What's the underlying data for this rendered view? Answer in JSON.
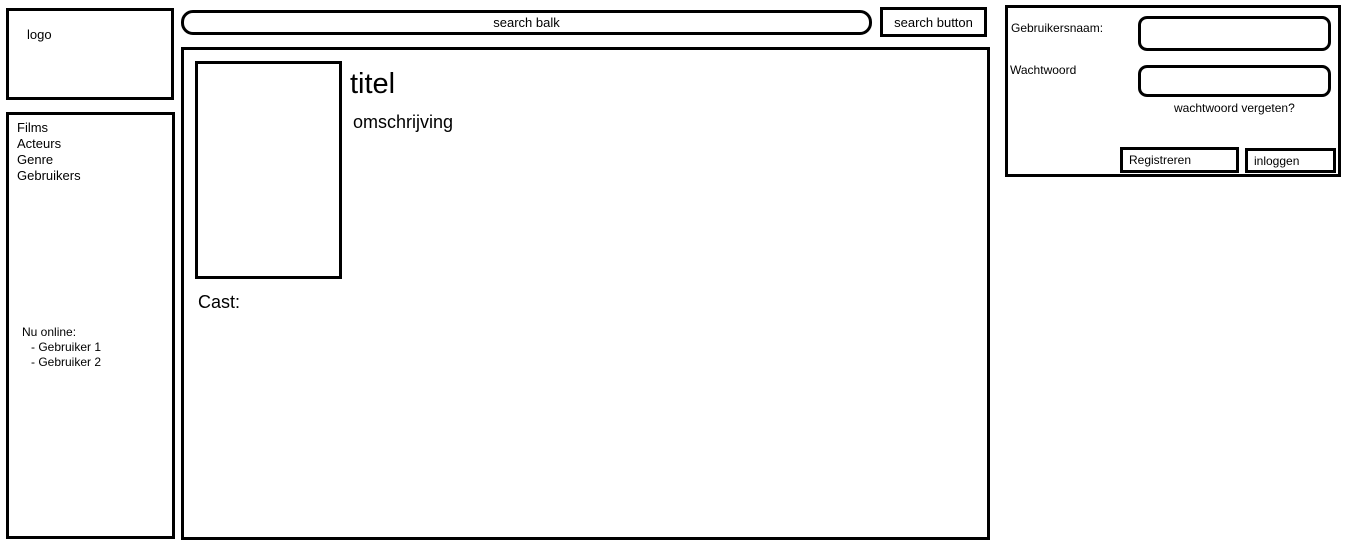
{
  "logo": {
    "text": "logo"
  },
  "search": {
    "placeholder": "search balk",
    "button_label": "search button"
  },
  "sidebar": {
    "items": [
      {
        "label": "Films"
      },
      {
        "label": "Acteurs"
      },
      {
        "label": "Genre"
      },
      {
        "label": "Gebruikers"
      }
    ],
    "online": {
      "heading": "Nu online:",
      "users": [
        "- Gebruiker 1",
        "- Gebruiker 2"
      ]
    }
  },
  "main": {
    "title": "titel",
    "description": "omschrijving",
    "cast_label": "Cast:"
  },
  "login": {
    "username_label": "Gebruikersnaam:",
    "password_label": "Wachtwoord",
    "forgot_label": "wachtwoord vergeten?",
    "register_label": "Registreren",
    "login_label": "inloggen"
  }
}
